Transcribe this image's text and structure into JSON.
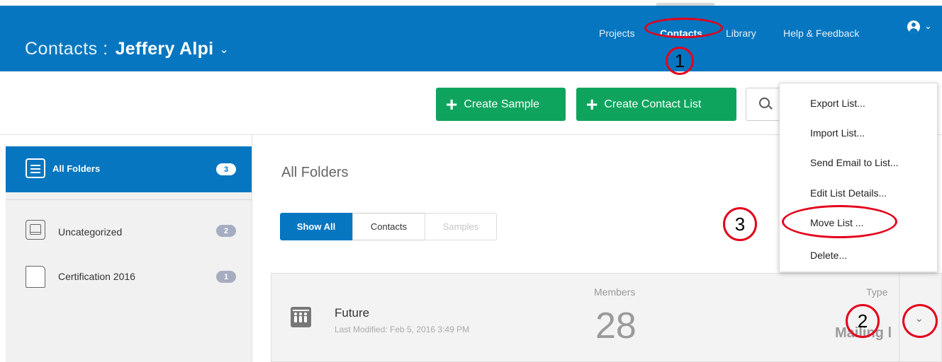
{
  "header": {
    "title_prefix": "Contacts :",
    "title_name": "Jeffery Alpi",
    "title_chevron": "⌄",
    "nav": [
      {
        "label": "Projects",
        "active": false
      },
      {
        "label": "Contacts",
        "active": true
      },
      {
        "label": "Library",
        "active": false
      },
      {
        "label": "Help & Feedback",
        "active": false
      }
    ],
    "user_chevron": "⌄"
  },
  "annotations": {
    "marker_1": "1",
    "marker_2": "2",
    "marker_3": "3"
  },
  "toolbar": {
    "create_sample_label": "Create Sample",
    "create_contact_list_label": "Create Contact List",
    "plus": "+"
  },
  "sidebar": {
    "items": [
      {
        "label": "All Folders",
        "count": "3",
        "active": true
      },
      {
        "label": "Uncategorized",
        "count": "2",
        "active": false
      },
      {
        "label": "Certification 2016",
        "count": "1",
        "active": false
      }
    ]
  },
  "main": {
    "title": "All Folders",
    "filters": [
      {
        "label": "Show All",
        "state": "selected"
      },
      {
        "label": "Contacts",
        "state": "normal"
      },
      {
        "label": "Samples",
        "state": "disabled"
      }
    ],
    "list": {
      "name": "Future",
      "last_modified": "Last Modified: Feb 5, 2016 3:49 PM",
      "members_label": "Members",
      "members_count": "28",
      "type_label": "Type",
      "type_value": "Mailing l",
      "chevron": "⌄"
    }
  },
  "dropdown": {
    "items": [
      "Export List...",
      "Import List...",
      "Send Email to List...",
      "Edit List Details...",
      "Move List ...",
      "Delete..."
    ]
  },
  "colors": {
    "brand_blue": "#0676c0",
    "green": "#0fa45d",
    "annotation_red": "#e3001b"
  }
}
